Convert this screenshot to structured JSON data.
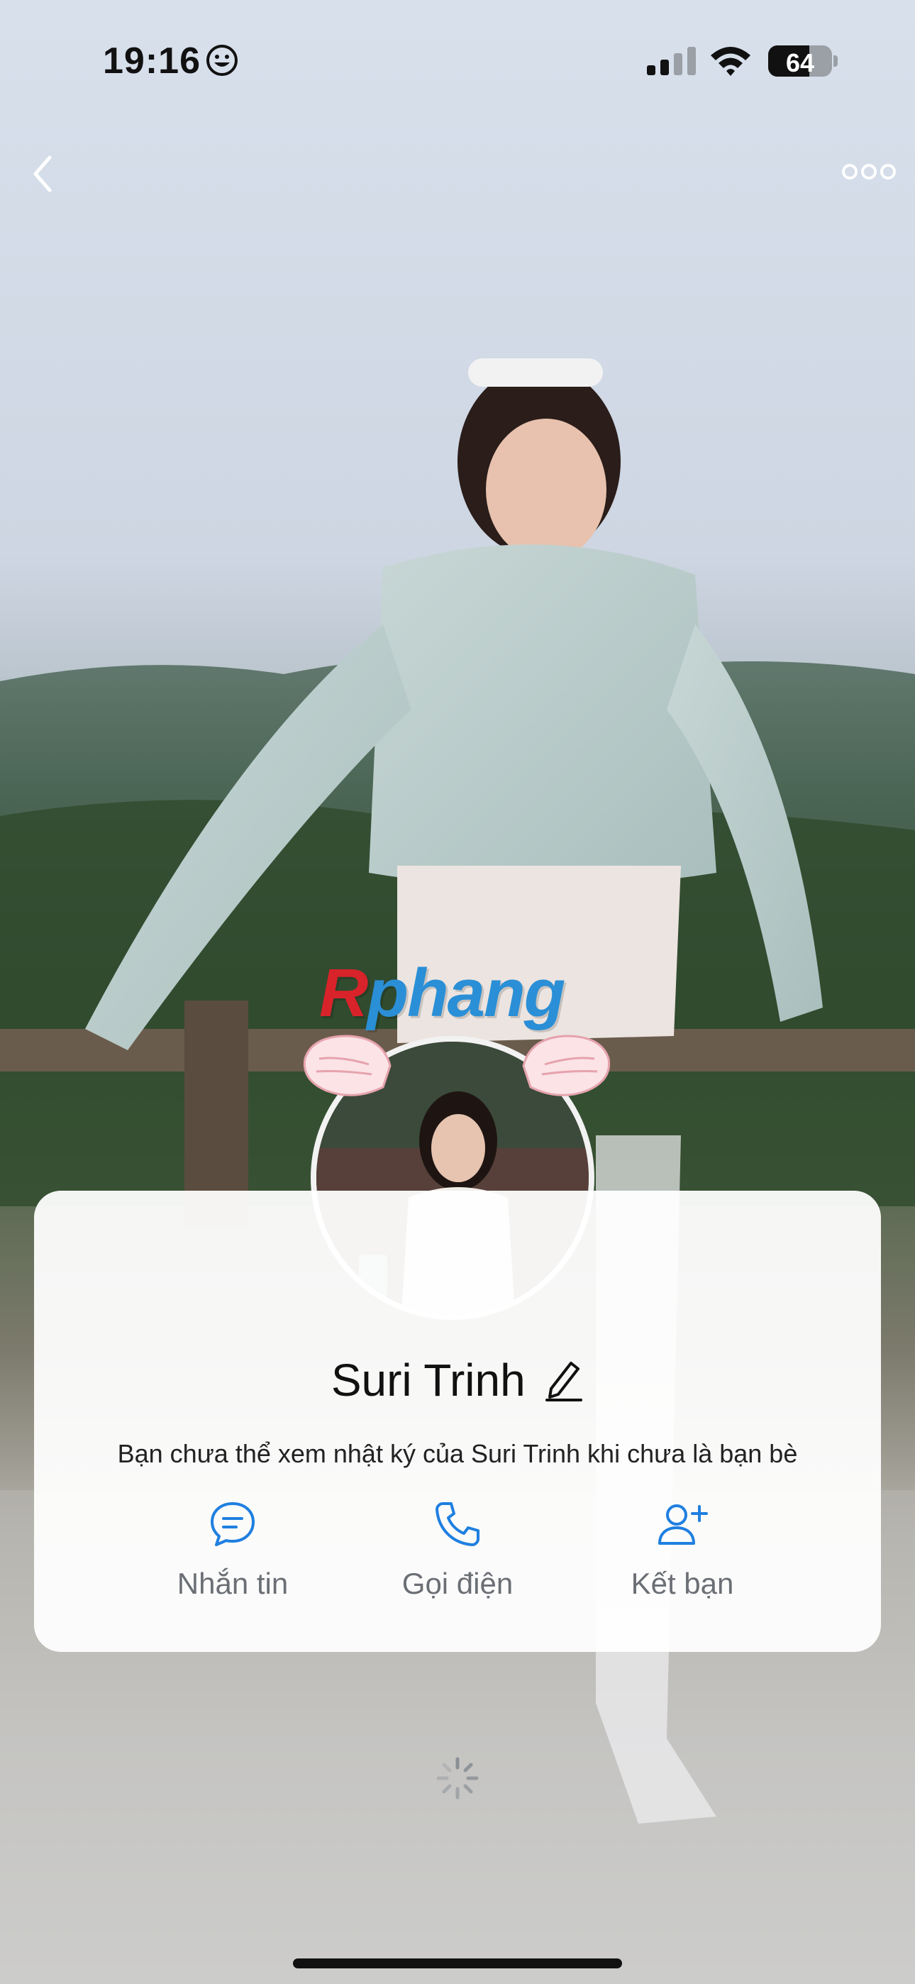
{
  "status_bar": {
    "time": "19:16",
    "battery_level": "64",
    "emoji_icon": "smiley-face-icon",
    "signal_icon": "cellular-signal-icon",
    "wifi_icon": "wifi-icon"
  },
  "navigation": {
    "back_icon": "chevron-left-icon",
    "more_icon": "more-dots-icon"
  },
  "watermark": {
    "first_letter": "R",
    "rest": "phang"
  },
  "profile": {
    "name": "Suri Trinh",
    "edit_icon": "pencil-icon",
    "notice": "Bạn chưa thể xem nhật ký của Suri Trinh khi chưa là bạn bè"
  },
  "actions": [
    {
      "label": "Nhắn tin",
      "icon": "chat-bubble-icon"
    },
    {
      "label": "Gọi điện",
      "icon": "phone-icon"
    },
    {
      "label": "Kết bạn",
      "icon": "add-friend-icon"
    }
  ],
  "colors": {
    "accent": "#1f7fe0",
    "action_label": "#6b6f75",
    "card_bg": "#ffffff"
  }
}
